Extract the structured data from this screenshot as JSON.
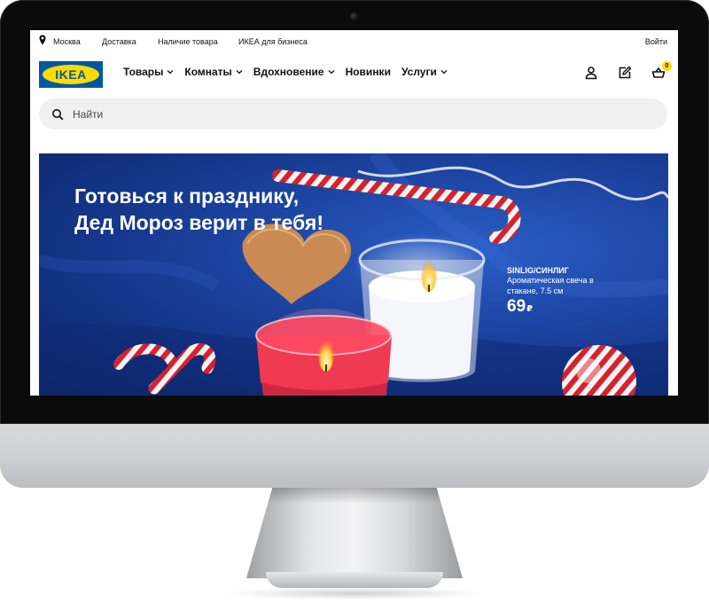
{
  "utility_bar": {
    "location": "Москва",
    "links": [
      "Доставка",
      "Наличие товара",
      "ИКЕА для бизнеса"
    ],
    "login": "Войти"
  },
  "header": {
    "logo_text": "IKEA",
    "nav": [
      {
        "label": "Товары",
        "has_dropdown": true
      },
      {
        "label": "Комнаты",
        "has_dropdown": true
      },
      {
        "label": "Вдохновение",
        "has_dropdown": true
      },
      {
        "label": "Новинки",
        "has_dropdown": false
      },
      {
        "label": "Услуги",
        "has_dropdown": true
      }
    ],
    "icons": [
      "user-icon",
      "shopping-list-icon",
      "cart-icon"
    ],
    "cart_count": "0"
  },
  "search": {
    "placeholder": "Найти"
  },
  "hero": {
    "title_line1": "Готовься к празднику,",
    "title_line2": "Дед Мороз верит в тебя!",
    "product_name": "SINLIG/СИНЛИГ",
    "product_desc": "Ароматическая свеча в стакане, 7.5 см",
    "price": "69",
    "currency": "₽"
  },
  "colors": {
    "ikea_blue": "#0058a3",
    "ikea_yellow": "#ffdb00",
    "hero_blue": "#1c43a0"
  }
}
